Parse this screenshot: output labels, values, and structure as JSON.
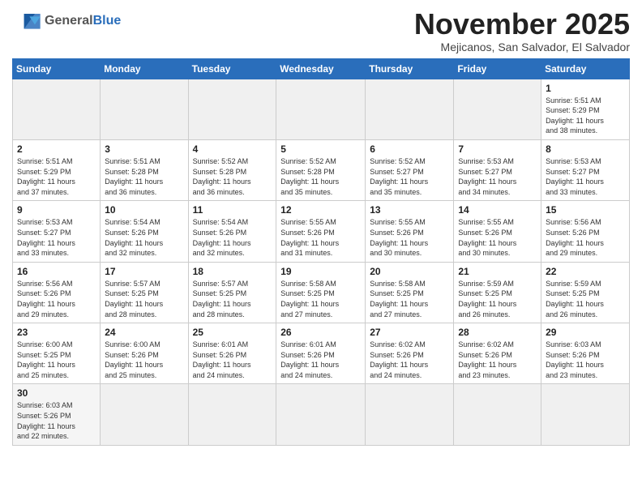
{
  "header": {
    "logo_line1": "General",
    "logo_line2": "Blue",
    "month_title": "November 2025",
    "location": "Mejicanos, San Salvador, El Salvador"
  },
  "weekdays": [
    "Sunday",
    "Monday",
    "Tuesday",
    "Wednesday",
    "Thursday",
    "Friday",
    "Saturday"
  ],
  "weeks": [
    [
      {
        "day": "",
        "info": ""
      },
      {
        "day": "",
        "info": ""
      },
      {
        "day": "",
        "info": ""
      },
      {
        "day": "",
        "info": ""
      },
      {
        "day": "",
        "info": ""
      },
      {
        "day": "",
        "info": ""
      },
      {
        "day": "1",
        "info": "Sunrise: 5:51 AM\nSunset: 5:29 PM\nDaylight: 11 hours\nand 38 minutes."
      }
    ],
    [
      {
        "day": "2",
        "info": "Sunrise: 5:51 AM\nSunset: 5:29 PM\nDaylight: 11 hours\nand 37 minutes."
      },
      {
        "day": "3",
        "info": "Sunrise: 5:51 AM\nSunset: 5:28 PM\nDaylight: 11 hours\nand 36 minutes."
      },
      {
        "day": "4",
        "info": "Sunrise: 5:52 AM\nSunset: 5:28 PM\nDaylight: 11 hours\nand 36 minutes."
      },
      {
        "day": "5",
        "info": "Sunrise: 5:52 AM\nSunset: 5:28 PM\nDaylight: 11 hours\nand 35 minutes."
      },
      {
        "day": "6",
        "info": "Sunrise: 5:52 AM\nSunset: 5:27 PM\nDaylight: 11 hours\nand 35 minutes."
      },
      {
        "day": "7",
        "info": "Sunrise: 5:53 AM\nSunset: 5:27 PM\nDaylight: 11 hours\nand 34 minutes."
      },
      {
        "day": "8",
        "info": "Sunrise: 5:53 AM\nSunset: 5:27 PM\nDaylight: 11 hours\nand 33 minutes."
      }
    ],
    [
      {
        "day": "9",
        "info": "Sunrise: 5:53 AM\nSunset: 5:27 PM\nDaylight: 11 hours\nand 33 minutes."
      },
      {
        "day": "10",
        "info": "Sunrise: 5:54 AM\nSunset: 5:26 PM\nDaylight: 11 hours\nand 32 minutes."
      },
      {
        "day": "11",
        "info": "Sunrise: 5:54 AM\nSunset: 5:26 PM\nDaylight: 11 hours\nand 32 minutes."
      },
      {
        "day": "12",
        "info": "Sunrise: 5:55 AM\nSunset: 5:26 PM\nDaylight: 11 hours\nand 31 minutes."
      },
      {
        "day": "13",
        "info": "Sunrise: 5:55 AM\nSunset: 5:26 PM\nDaylight: 11 hours\nand 30 minutes."
      },
      {
        "day": "14",
        "info": "Sunrise: 5:55 AM\nSunset: 5:26 PM\nDaylight: 11 hours\nand 30 minutes."
      },
      {
        "day": "15",
        "info": "Sunrise: 5:56 AM\nSunset: 5:26 PM\nDaylight: 11 hours\nand 29 minutes."
      }
    ],
    [
      {
        "day": "16",
        "info": "Sunrise: 5:56 AM\nSunset: 5:26 PM\nDaylight: 11 hours\nand 29 minutes."
      },
      {
        "day": "17",
        "info": "Sunrise: 5:57 AM\nSunset: 5:25 PM\nDaylight: 11 hours\nand 28 minutes."
      },
      {
        "day": "18",
        "info": "Sunrise: 5:57 AM\nSunset: 5:25 PM\nDaylight: 11 hours\nand 28 minutes."
      },
      {
        "day": "19",
        "info": "Sunrise: 5:58 AM\nSunset: 5:25 PM\nDaylight: 11 hours\nand 27 minutes."
      },
      {
        "day": "20",
        "info": "Sunrise: 5:58 AM\nSunset: 5:25 PM\nDaylight: 11 hours\nand 27 minutes."
      },
      {
        "day": "21",
        "info": "Sunrise: 5:59 AM\nSunset: 5:25 PM\nDaylight: 11 hours\nand 26 minutes."
      },
      {
        "day": "22",
        "info": "Sunrise: 5:59 AM\nSunset: 5:25 PM\nDaylight: 11 hours\nand 26 minutes."
      }
    ],
    [
      {
        "day": "23",
        "info": "Sunrise: 6:00 AM\nSunset: 5:25 PM\nDaylight: 11 hours\nand 25 minutes."
      },
      {
        "day": "24",
        "info": "Sunrise: 6:00 AM\nSunset: 5:26 PM\nDaylight: 11 hours\nand 25 minutes."
      },
      {
        "day": "25",
        "info": "Sunrise: 6:01 AM\nSunset: 5:26 PM\nDaylight: 11 hours\nand 24 minutes."
      },
      {
        "day": "26",
        "info": "Sunrise: 6:01 AM\nSunset: 5:26 PM\nDaylight: 11 hours\nand 24 minutes."
      },
      {
        "day": "27",
        "info": "Sunrise: 6:02 AM\nSunset: 5:26 PM\nDaylight: 11 hours\nand 24 minutes."
      },
      {
        "day": "28",
        "info": "Sunrise: 6:02 AM\nSunset: 5:26 PM\nDaylight: 11 hours\nand 23 minutes."
      },
      {
        "day": "29",
        "info": "Sunrise: 6:03 AM\nSunset: 5:26 PM\nDaylight: 11 hours\nand 23 minutes."
      }
    ],
    [
      {
        "day": "30",
        "info": "Sunrise: 6:03 AM\nSunset: 5:26 PM\nDaylight: 11 hours\nand 22 minutes."
      },
      {
        "day": "",
        "info": ""
      },
      {
        "day": "",
        "info": ""
      },
      {
        "day": "",
        "info": ""
      },
      {
        "day": "",
        "info": ""
      },
      {
        "day": "",
        "info": ""
      },
      {
        "day": "",
        "info": ""
      }
    ]
  ]
}
